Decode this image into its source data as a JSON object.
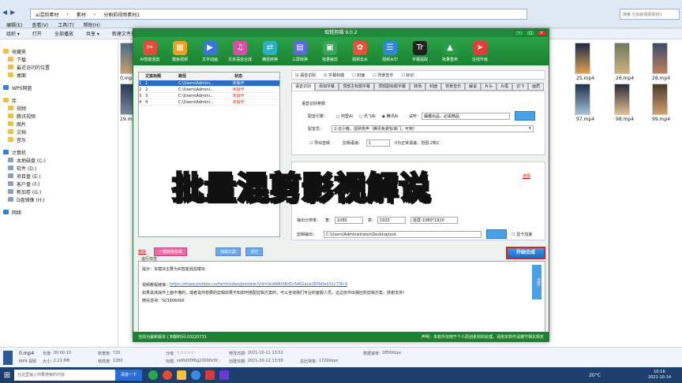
{
  "explorer": {
    "crumbs": [
      "ai混剪素材",
      "素材",
      "分割前视频素材1"
    ],
    "search_placeholder": "搜索 分割前视频素材1",
    "menu": [
      "组织 ▾",
      "编辑(E)",
      "查看(V)",
      "工具(T)",
      "帮助(H)"
    ],
    "toolbar": [
      "组织 ▾",
      "打开",
      "全部播放",
      "共享 ▾",
      "新建文件夹"
    ],
    "sidebar": [
      {
        "label": "收藏夹",
        "icon": "star-icon",
        "top": true
      },
      {
        "label": "下载",
        "icon": "folder-icon"
      },
      {
        "label": "最近访问的位置",
        "icon": "folder-icon"
      },
      {
        "label": "桌面",
        "icon": "desktop-icon"
      },
      {
        "label": "WPS网盘",
        "icon": "cloud-icon",
        "top": true
      },
      {
        "label": "库",
        "icon": "library-icon",
        "top": true
      },
      {
        "label": "视频",
        "icon": "folder-icon"
      },
      {
        "label": "腾讯视频",
        "icon": "folder-icon"
      },
      {
        "label": "图片",
        "icon": "folder-icon"
      },
      {
        "label": "文档",
        "icon": "folder-icon"
      },
      {
        "label": "音乐",
        "icon": "folder-icon"
      },
      {
        "label": "计算机",
        "icon": "computer-icon",
        "top": true
      },
      {
        "label": "本地磁盘 (C:)",
        "icon": "drive-icon"
      },
      {
        "label": "软件 (D:)",
        "icon": "drive-icon"
      },
      {
        "label": "项目盘 (E:)",
        "icon": "drive-icon"
      },
      {
        "label": "客户盘 (F:)",
        "icon": "drive-icon"
      },
      {
        "label": "新加卷 (G:)",
        "icon": "drive-icon"
      },
      {
        "label": "D盘镜像 (H:)",
        "icon": "drive-icon"
      },
      {
        "label": "网络",
        "icon": "network-icon",
        "top": true
      }
    ],
    "thumb_labels": [
      "0.mp4",
      "29.mp4",
      "25.mp4",
      "26.mp4",
      "28.mp4",
      "97.mp4",
      "98.mp4",
      "99.mp4"
    ],
    "details": {
      "name": "0.mp4",
      "type": "MP4 视频",
      "length_label": "长度:",
      "length": "00:00:10",
      "size_label": "大小:",
      "size": "2.21 MB",
      "width_label": "帧宽度:",
      "width": "720",
      "height_label": "帧高度:",
      "height": "1280",
      "rating_label": "分级:",
      "rating": "☆☆☆☆☆",
      "title_label": "标题:",
      "title": "vid0d00f6g10000c5f...",
      "mod_label": "修改日期:",
      "mod": "2021-10-11 13:51",
      "create_label": "创建日期:",
      "create": "2021-10-12 13:56",
      "bitrate_label": "总比特率:",
      "bitrate": "1720kbps",
      "databitrate_label": "数据速率:",
      "databitrate": "1850kbps"
    },
    "taskbar": {
      "search": "在这里输入你要搜索的内容",
      "baidu": "百度一下",
      "temp": "20°C",
      "time": "10:16",
      "date": "2021-10-14"
    }
  },
  "app": {
    "title": "蚁蛏剪辑 9.0.2",
    "tools": [
      {
        "label": "AI智能混剪",
        "color": "#e64a3a",
        "glyph": "✂"
      },
      {
        "label": "模板视频",
        "color": "#f0a020",
        "glyph": "▦"
      },
      {
        "label": "文字动画",
        "color": "#3a78d8",
        "glyph": "▶"
      },
      {
        "label": "文本语音合成",
        "color": "#d84fa8",
        "glyph": "♫"
      },
      {
        "label": "横竖转换",
        "color": "#2bb0c8",
        "glyph": "⇄"
      },
      {
        "label": "三屏转换",
        "color": "#5b6ad8",
        "glyph": "▤"
      },
      {
        "label": "批量裁剪",
        "color": "#3aa55a",
        "glyph": "▣"
      },
      {
        "label": "视频去水",
        "color": "#e8503a",
        "glyph": "✿"
      },
      {
        "label": "视频水印",
        "color": "#2e8ad8",
        "glyph": "☰"
      },
      {
        "label": "字幕提取",
        "color": "#222222",
        "glyph": "Tr"
      },
      {
        "label": "批量重命",
        "color": "#2a9a4a",
        "glyph": "▲"
      },
      {
        "label": "在线升级",
        "color": "#e83a3a",
        "glyph": "➤"
      }
    ],
    "table": {
      "headers": [
        "文案标题",
        "路径",
        "状态"
      ],
      "rows": [
        {
          "n": "1",
          "title": "1",
          "path": "C:\\Users\\Admini...",
          "status": "未操作"
        },
        {
          "n": "2",
          "title": "2",
          "path": "C:\\Users\\Admini...",
          "status": "未操作"
        },
        {
          "n": "3",
          "title": "3",
          "path": "C:\\Users\\Admini...",
          "status": "未操作"
        },
        {
          "n": "4",
          "title": "4",
          "path": "C:\\Users\\Admini...",
          "status": "未操作"
        }
      ]
    },
    "left_buttons": {
      "delete": "删除",
      "one_click": "一键转换加载",
      "load": "加载文案",
      "clear": "清空"
    },
    "options": [
      "语音识别",
      "字幕标题",
      "封面",
      "背景音乐",
      "标识"
    ],
    "tabs": [
      "语音识别",
      "添加字幕",
      "顶部主标题字幕",
      "顶部副标题字幕",
      "转场",
      "封面",
      "背景音乐",
      "解说",
      "片头",
      "片尾",
      "识飞",
      "画质"
    ],
    "speech": {
      "group": "语音识别参数",
      "engine_label": "配音引擎：",
      "engines": [
        "阿里AI",
        "讯飞AI",
        "腾讯AI"
      ],
      "preview_label": "试听：",
      "preview_text": "蛹蠟出品，必属精品",
      "voice_label": "配音员：",
      "voice": "2-云小晚，成熟男声（腾讯免费标准门，可用）",
      "export_label": "导出音频",
      "speed_label": "剪辑语速：",
      "speed": "1",
      "speed_hint": "0为正常语速，范围-2到2"
    },
    "output": {
      "res_label": "输出分辨率：",
      "w_label": "宽：",
      "w": "1080",
      "h_label": "高：",
      "h": "1920",
      "preset": "竖屏-1080*1920",
      "path_label": "剪辑输出：",
      "path": "C:\\Users\\Administrator\\Desktop\\out",
      "gpu_label": "显卡加速",
      "link": "选择"
    },
    "start_button": "开始合成",
    "log": {
      "title": "运行日志",
      "tip": "提示：本模块主要为AI智能混剪模块",
      "tutorial_label": "视频教程链接：",
      "tutorial_url": "https://share.plvideo.cn/front/video/preview?vid=0cd9d038d1c5401ace267b0e151c77b-0",
      "note": "如果具体操作上面不懂的，或者说你想要的剪辑效果不知如何搭配剪辑方案的，可以咨询我们专业的客服人员，这边协作出相应的剪辑方案，感谢支持！",
      "contact": "微信咨询：503906066",
      "clear": "清空"
    },
    "status_left": "当前为最新版本 | 到期时间:20220731",
    "status_right": "声明：本软件仅用于个人原创素材的处理，请用本软件请遵守相关规定"
  },
  "overlay_banner": "批量混剪影视解说",
  "colors": {
    "app_green": "#1e8a3a",
    "banner_yellow": "#ffe400"
  }
}
